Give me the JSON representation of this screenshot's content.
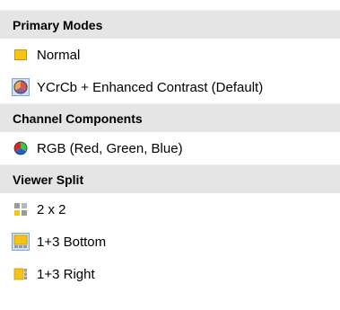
{
  "menu": {
    "sections": [
      {
        "header": "Primary Modes",
        "items": [
          {
            "label": "Normal",
            "icon": "yellow-square-icon",
            "selected": false
          },
          {
            "label": "YCrCb + Enhanced Contrast (Default)",
            "icon": "color-pie-icon",
            "selected": true
          }
        ]
      },
      {
        "header": "Channel Components",
        "items": [
          {
            "label": "RGB  (Red, Green, Blue)",
            "icon": "rgb-wheel-icon",
            "selected": false
          }
        ]
      },
      {
        "header": "Viewer Split",
        "items": [
          {
            "label": "2 x 2",
            "icon": "grid-2x2-icon",
            "selected": false
          },
          {
            "label": "1+3 Bottom",
            "icon": "split-bottom-icon",
            "selected": true
          },
          {
            "label": "1+3 Right",
            "icon": "split-right-icon",
            "selected": false
          }
        ]
      }
    ]
  },
  "colors": {
    "header_bg": "#e5e5e5",
    "selected_bg": "#cce0f5",
    "selected_border": "#7aa7d6",
    "icon_yellow": "#f5c518"
  }
}
